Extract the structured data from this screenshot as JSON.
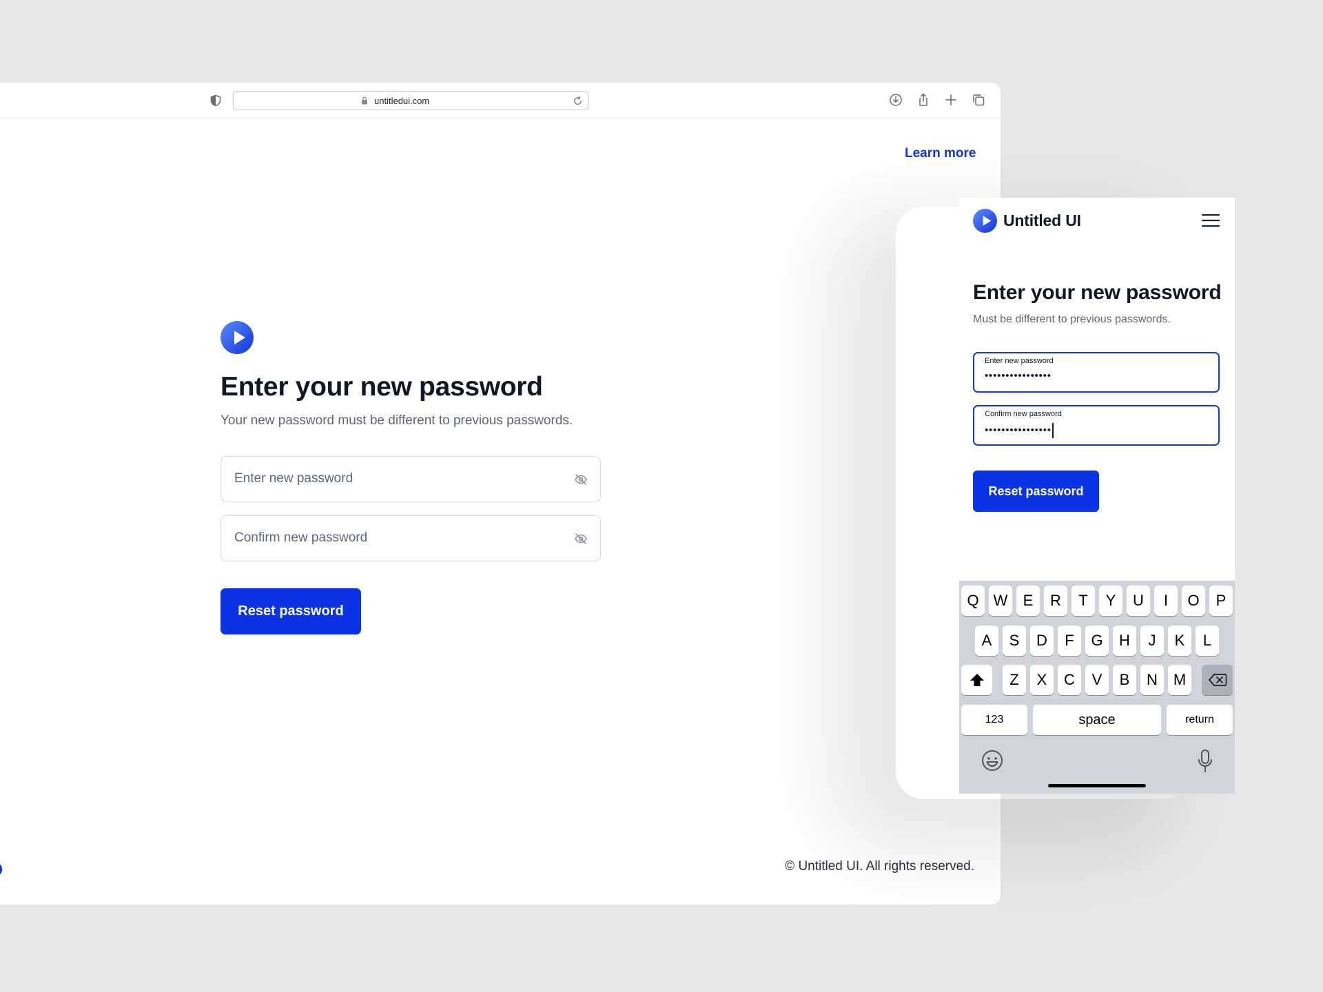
{
  "browser": {
    "url": "untitledui.com",
    "learn_more": "Learn more",
    "title": "Enter your new password",
    "subtitle": "Your new password must be different to previous passwords.",
    "new_password_placeholder": "Enter new password",
    "confirm_password_placeholder": "Confirm new password",
    "reset_button": "Reset password",
    "footer": "© Untitled UI. All rights reserved."
  },
  "mobile": {
    "brand": "Untitled UI",
    "title": "Enter your new password",
    "subtitle": "Must be different to previous passwords.",
    "new_password_label": "Enter new password",
    "new_password_value": "••••••••••••••••",
    "confirm_password_label": "Confirm new password",
    "confirm_password_value": "••••••••••••••••",
    "reset_button": "Reset password"
  },
  "keyboard": {
    "row1": [
      "Q",
      "W",
      "E",
      "R",
      "T",
      "Y",
      "U",
      "I",
      "O",
      "P"
    ],
    "row2": [
      "A",
      "S",
      "D",
      "F",
      "G",
      "H",
      "J",
      "K",
      "L"
    ],
    "row3": [
      "Z",
      "X",
      "C",
      "V",
      "B",
      "N",
      "M"
    ],
    "numbers": "123",
    "space": "space",
    "return": "return"
  },
  "colors": {
    "accent": "#0b33e6",
    "link": "#1234d8",
    "text": "#101828",
    "muted": "#5f6774"
  }
}
